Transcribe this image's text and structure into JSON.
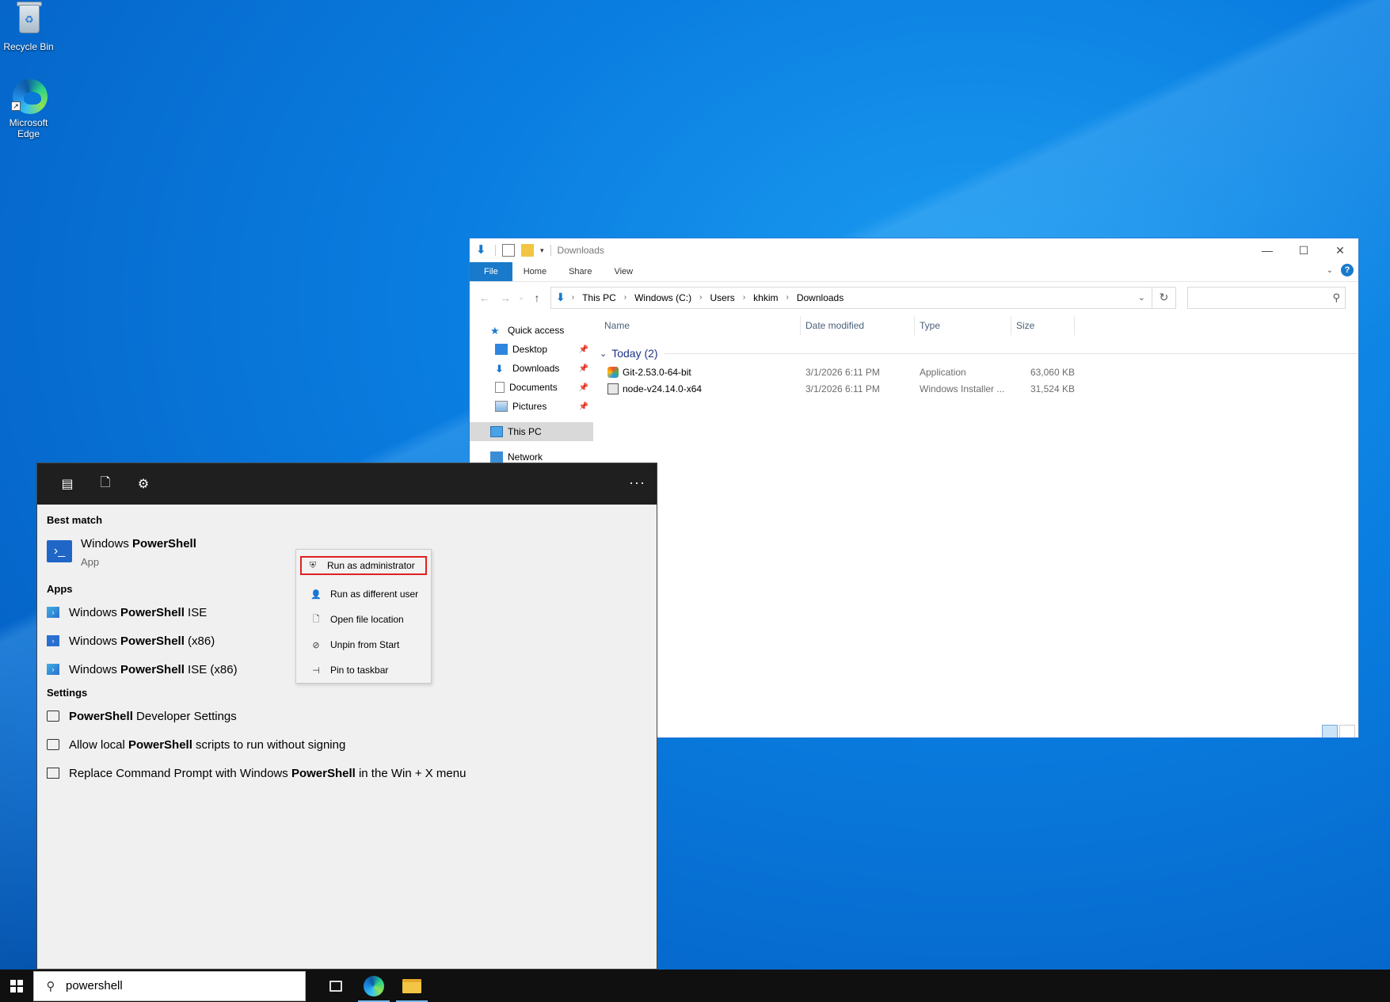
{
  "desktop": {
    "icons": [
      {
        "label": "Recycle Bin",
        "icon": "recycle-bin-icon"
      },
      {
        "label": "Microsoft\nEdge",
        "icon": "edge-icon"
      }
    ]
  },
  "explorer": {
    "title": "Downloads",
    "ribbon_tabs": [
      "File",
      "Home",
      "Share",
      "View"
    ],
    "breadcrumb": [
      "This PC",
      "Windows (C:)",
      "Users",
      "khkim",
      "Downloads"
    ],
    "search_placeholder": "",
    "nav": {
      "quick_access": "Quick access",
      "pinned": [
        "Desktop",
        "Downloads",
        "Documents",
        "Pictures"
      ],
      "this_pc": "This PC",
      "network": "Network"
    },
    "columns": [
      "Name",
      "Date modified",
      "Type",
      "Size"
    ],
    "group": "Today (2)",
    "files": [
      {
        "name": "Git-2.53.0-64-bit",
        "date": "3/1/2026 6:11 PM",
        "type": "Application",
        "size": "63,060 KB"
      },
      {
        "name": "node-v24.14.0-x64",
        "date": "3/1/2026 6:11 PM",
        "type": "Windows Installer ...",
        "size": "31,524 KB"
      }
    ]
  },
  "search_panel": {
    "best_match_title": "Best match",
    "best_match": {
      "name_prefix": "Windows ",
      "name_bold": "PowerShell",
      "sub": "App"
    },
    "apps_title": "Apps",
    "apps": [
      {
        "prefix": "Windows ",
        "bold": "PowerShell",
        "suffix": " ISE"
      },
      {
        "prefix": "Windows ",
        "bold": "PowerShell",
        "suffix": " (x86)"
      },
      {
        "prefix": "Windows ",
        "bold": "PowerShell",
        "suffix": " ISE (x86)"
      }
    ],
    "settings_title": "Settings",
    "settings": [
      {
        "prefix": "",
        "bold": "PowerShell",
        "suffix": " Developer Settings"
      },
      {
        "prefix": "Allow local ",
        "bold": "PowerShell",
        "suffix": " scripts to run without signing"
      },
      {
        "prefix": "Replace Command Prompt with Windows ",
        "bold": "PowerShell",
        "suffix": " in the Win + X menu"
      }
    ],
    "more": "···"
  },
  "context_menu": [
    {
      "label": "Run as administrator",
      "icon": "shield-icon"
    },
    {
      "label": "Run as different user",
      "icon": "user-icon"
    },
    {
      "label": "Open file location",
      "icon": "file-location-icon"
    },
    {
      "label": "Unpin from Start",
      "icon": "unpin-icon"
    },
    {
      "label": "Pin to taskbar",
      "icon": "pin-icon"
    }
  ],
  "taskbar": {
    "search_text": "powershell"
  }
}
